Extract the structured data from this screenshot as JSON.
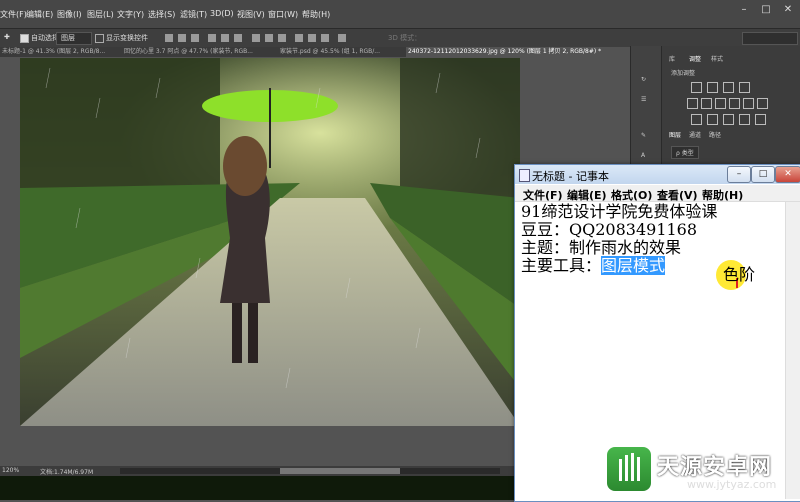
{
  "menu": [
    "文件(F)",
    "编辑(E)",
    "图像(I)",
    "图层(L)",
    "文字(Y)",
    "选择(S)",
    "滤镜(T)",
    "3D(D)",
    "视图(V)",
    "窗口(W)",
    "帮助(H)"
  ],
  "options": {
    "auto_select": "自动选择：",
    "auto_select_value": "图层",
    "show_transform": "显示变换控件",
    "mode_3d": "3D 模式：",
    "workspace": ""
  },
  "tabs": [
    "未标题-1 @ 41.3% (图层 2, RGB/8...",
    "回忆的心里 3.7 阿点 @ 47.7% (家装节, RGB...",
    "家装节.psd @ 45.5% (组 1, RGB/...",
    "240372-12112012033629.jpg @ 120% (图层 1 拷贝 2, RGB/8#) *"
  ],
  "status": {
    "zoom": "120%",
    "doc": "文档:1.74M/6.97M"
  },
  "panels": {
    "tab1": "库",
    "tab2": "调整",
    "tab3": "样式",
    "add_adjustment": "添加调整",
    "layers_tab": "图层",
    "channels_tab": "通道",
    "paths_tab": "路径",
    "kind": "ρ 类型"
  },
  "notepad": {
    "title": "无标题 - 记事本",
    "menu": [
      "文件(F)",
      "编辑(E)",
      "格式(O)",
      "查看(V)",
      "帮助(H)"
    ],
    "lines": [
      "91缔范设计学院免费体验课",
      "豆豆：QQ2083491168",
      "主题：制作雨水的效果"
    ],
    "line4_prefix": "主要工具：",
    "line4_selected": "图层模式",
    "extra_word": "色阶"
  },
  "watermark": {
    "name": "天源安卓网",
    "url": "www.jytyaz.com"
  },
  "colors": {
    "accent_green": "#8ee02a",
    "selection": "#3399ff"
  }
}
